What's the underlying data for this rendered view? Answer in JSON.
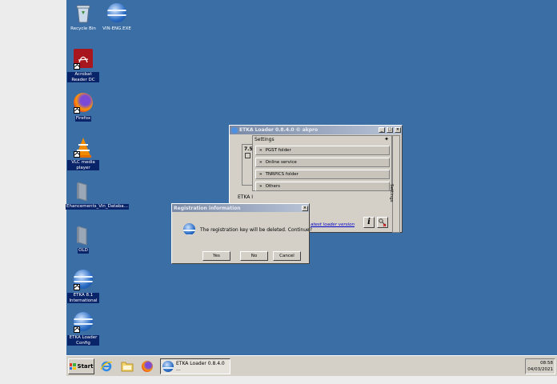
{
  "desktop": {
    "icons": [
      {
        "label": "Recycle Bin"
      },
      {
        "label": "VIN-ENG.EXE"
      },
      {
        "label": "Acrobat Reader DC"
      },
      {
        "label": "Firefox"
      },
      {
        "label": "VLC media player"
      },
      {
        "label": "Ehancements_Vin_Databa..."
      },
      {
        "label": "OLD"
      },
      {
        "label": "ETKA 8.1 International"
      },
      {
        "label": "ETKA Loader Config"
      }
    ]
  },
  "etka_window": {
    "title": "ETKA Loader 0.8.4.0 © akpro",
    "panel_title": "Settings",
    "menu": [
      "PGST folder",
      "Online service",
      "TNRPICS folder",
      "Others"
    ],
    "side_label": "7.5",
    "etka_label": "ETKA I",
    "latest_link": "atest loader version",
    "side_tab": "Settings",
    "info_button": "i"
  },
  "dialog": {
    "title": "Registration information",
    "message": "The registration key will be deleted. Continue?",
    "buttons": {
      "yes": "Yes",
      "no": "No",
      "cancel": "Cancel"
    }
  },
  "taskbar": {
    "start_label": "Start",
    "task_label": "ETKA Loader 0.8.4.0 ...",
    "time": "08:58",
    "date": "04/03/2021"
  },
  "colors": {
    "desktop": "#3a6ea5",
    "taskbar": "#d4d0c8",
    "title_active": "#0a246a"
  }
}
